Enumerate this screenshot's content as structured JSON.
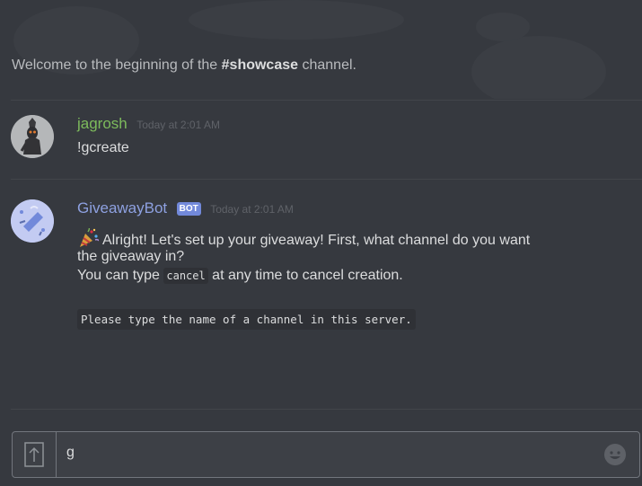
{
  "welcome": {
    "prefix": "Welcome to the beginning of the ",
    "channel": "#showcase",
    "suffix": " channel."
  },
  "messages": [
    {
      "author": "jagrosh",
      "author_color": "#7dbb5c",
      "timestamp": "Today at 2:01 AM",
      "text": "!gcreate"
    },
    {
      "author": "GiveawayBot",
      "author_color": "#8ea1e1",
      "bot_tag": "BOT",
      "timestamp": "Today at 2:01 AM",
      "line1": "Alright! Let's set up your giveaway! First, what channel do you want",
      "line2": "the giveaway in?",
      "line3_prefix": "You can type ",
      "line3_code": "cancel",
      "line3_suffix": " at any time to cancel creation.",
      "code_block": "Please type the name of a channel in this server."
    }
  ],
  "input": {
    "value": "g"
  },
  "icons": {
    "upload": "upload-icon",
    "emoji": "emoji-icon",
    "party": "party-popper-icon"
  },
  "colors": {
    "background": "#36393f",
    "bot_tag": "#7289da"
  }
}
